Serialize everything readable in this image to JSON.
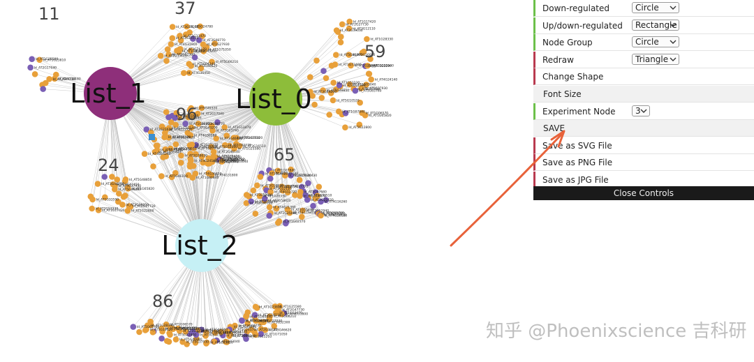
{
  "network": {
    "hubs": [
      {
        "id": "list_1",
        "label": "List_1",
        "color": "#8e2f7a"
      },
      {
        "id": "list_0",
        "label": "List_0",
        "color": "#8dbd3a"
      },
      {
        "id": "list_2",
        "label": "List_2",
        "color": "#c6f0f5"
      }
    ],
    "group_counts": [
      "11",
      "37",
      "59",
      "96",
      "24",
      "65",
      "86"
    ],
    "colors": {
      "gene": "#e8a03a",
      "gene_alt": "#7a5fb5",
      "edge": "#bdbdbd",
      "square": "#3c8fd0"
    },
    "gene_labels": [
      "Id_AT2G17040",
      "Id_AT4G30180",
      "Id_AT1G23810",
      "Id_AT1G25580",
      "Id_AT2G47730",
      "Id_AT1G13470",
      "Id_AT4G31800",
      "Id_AT5G66210",
      "Id_AT3G16510",
      "Id_AT1G80840",
      "Id_AT1G27930",
      "Id_AT5G52300",
      "Id_AT4G36450",
      "Id_AT5G24780",
      "Id_AT3G46620",
      "Id_AT1G71050",
      "Id_AT2G33120",
      "Id_AT3G08770",
      "Id_AT3G15210",
      "Id_AT2G43290",
      "Id_AT3G26170",
      "Id_AT5G04340",
      "Id_AT1G73480",
      "Id_AT4G24140",
      "Id_AT2G39030",
      "Id_AT1G03040",
      "Id_AT5G48850",
      "Id_AT1G65820",
      "Id_AT3G44260",
      "Id_AT1G17420",
      "Id_AT3G53230",
      "Id_AT2G27730",
      "Id_AT5G37930",
      "Id_AT5G46880",
      "Id_AT1G33590",
      "Id_AT5G22800",
      "Id_AT3G16050",
      "Id_AT3G47450",
      "Id_AT4G21390",
      "Id_AT2G25080",
      "Id_AT1G06570",
      "Id_AT5G10520",
      "Id_AT1G28330",
      "Id_AT5G65760",
      "Id_AT1G07840",
      "Id_AT3G12110",
      "Id_AT3G52940",
      "Id_AT2G37770",
      "Id_AT4G12720",
      "Id_AT5G49320",
      "Id_AT2G03740",
      "Id_AT5G46100",
      "Id_AT1G72510",
      "Id_AT3G58620",
      "Id_AT1G02370",
      "Id_AT5G26430",
      "Id_AT4G16400",
      "Id_AT2G21620",
      "Id_AT1G10140",
      "Id_AT3G07680",
      "Id_AT2G46140",
      "Id_AT4G33910",
      "Id_AT5G59880",
      "Id_AT1G55440",
      "Id_AT1G54410",
      "Id_AT4G16260"
    ]
  },
  "controls": {
    "rows": [
      {
        "label": "Down-regulated",
        "value": "Circle",
        "accent": "green"
      },
      {
        "label": "Up/down-regulated",
        "value": "Rectangle",
        "accent": "green"
      },
      {
        "label": "Node Group",
        "value": "Circle",
        "accent": "green"
      },
      {
        "label": "Redraw",
        "value": "Triangle",
        "accent": "red"
      },
      {
        "label": "Change Shape",
        "accent": "red"
      },
      {
        "label": "Font Size",
        "title": true
      },
      {
        "label": "Experiment Node",
        "value": "3",
        "accent": "green"
      },
      {
        "label": "SAVE",
        "title": true
      },
      {
        "label": "Save as SVG File",
        "accent": "red"
      },
      {
        "label": "Save as PNG File",
        "accent": "red"
      },
      {
        "label": "Save as JPG File",
        "accent": "red"
      }
    ],
    "close_label": "Close Controls"
  },
  "annotation": {
    "arrow_color": "#e8623a"
  },
  "watermark": "知乎 @Phoenixscience 吉科研"
}
